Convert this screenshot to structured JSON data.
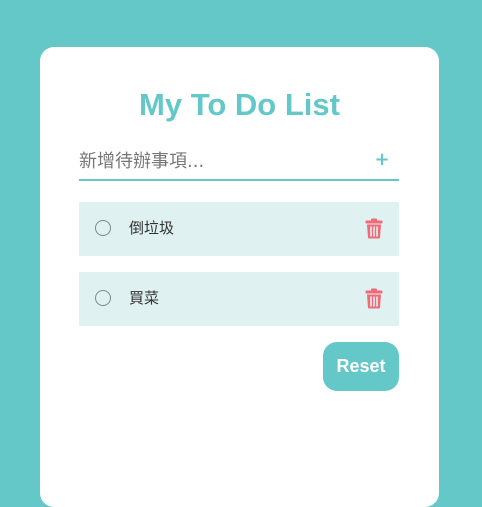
{
  "app": {
    "title": "My To Do List"
  },
  "input": {
    "placeholder": "新增待辦事項...",
    "value": "",
    "add_label": "+"
  },
  "todos": [
    {
      "text": "倒垃圾",
      "done": false
    },
    {
      "text": "買菜",
      "done": false
    }
  ],
  "actions": {
    "reset_label": "Reset"
  },
  "icons": {
    "add": "plus-icon",
    "check": "circle-checkbox-icon",
    "delete": "trash-icon"
  },
  "colors": {
    "background": "#64c8c8",
    "accent": "#64c8c8",
    "card": "#ffffff",
    "item_background": "#dff1f1",
    "delete": "#f06a78"
  }
}
